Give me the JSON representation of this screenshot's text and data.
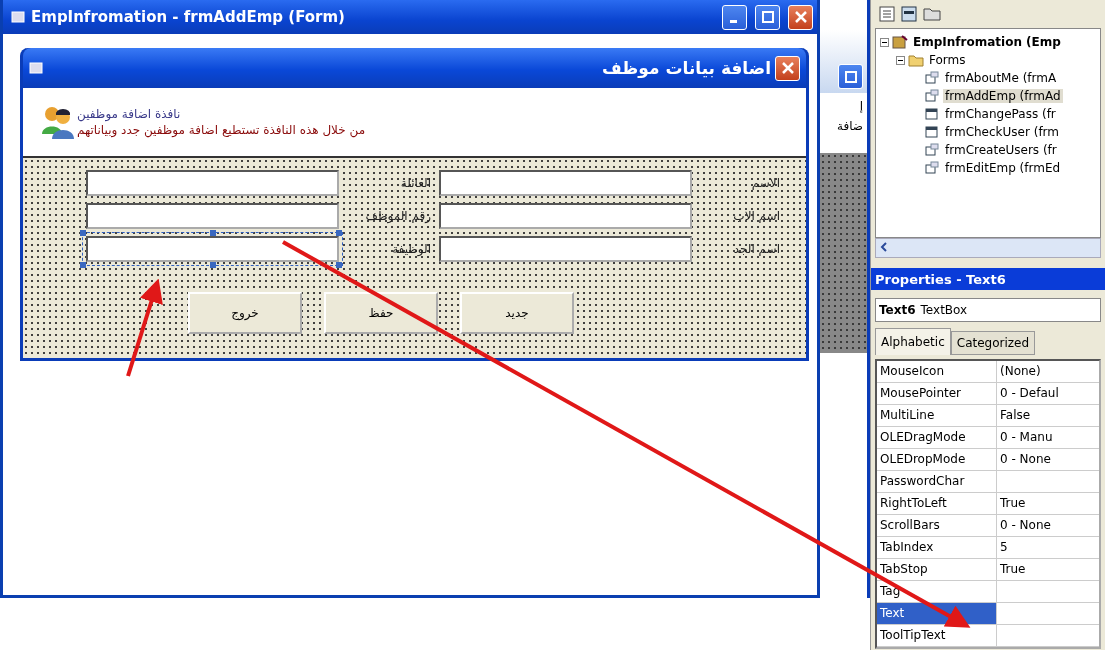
{
  "designer_window": {
    "title": "EmpInfromation - frmAddEmp (Form)"
  },
  "form": {
    "title": "اضافة بيانات موظف",
    "header_title": "نافذة اضافة موظفين",
    "header_text": "من خلال هذه النافذة تستطيع اضافة موظفين جدد وبياناتهم",
    "right_column": [
      {
        "label": "الاسم",
        "selected": false
      },
      {
        "label": "اسم الاب",
        "selected": false
      },
      {
        "label": "اسم الجد",
        "selected": false
      }
    ],
    "left_column": [
      {
        "label": "العائلة",
        "selected": false
      },
      {
        "label": "رقم الموظف",
        "selected": false
      },
      {
        "label": "الوظيفة",
        "selected": true
      }
    ],
    "buttons": [
      "جديد",
      "حفظ",
      "خروج"
    ]
  },
  "background_window": {
    "texts": [
      "إ",
      "ضافة"
    ]
  },
  "project": {
    "items": [
      {
        "label": "EmpInfromation (Emp",
        "kind": "project",
        "expanded": true,
        "selected": false,
        "children": [
          {
            "label": "Forms",
            "kind": "folder",
            "expanded": true,
            "selected": false,
            "children": [
              {
                "label": "frmAboutMe (frmA",
                "kind": "mdi-form",
                "selected": false
              },
              {
                "label": "frmAddEmp (frmAd",
                "kind": "mdi-form",
                "selected": true
              },
              {
                "label": "frmChangePass (fr",
                "kind": "form",
                "selected": false
              },
              {
                "label": "frmCheckUser (frm",
                "kind": "form",
                "selected": false
              },
              {
                "label": "frmCreateUsers (fr",
                "kind": "mdi-form",
                "selected": false
              },
              {
                "label": "frmEditEmp (frmEd",
                "kind": "mdi-form",
                "selected": false
              }
            ]
          }
        ]
      }
    ]
  },
  "properties": {
    "title": "Properties - Text6",
    "object_name": "Text6",
    "object_type": "TextBox",
    "tabs": [
      {
        "label": "Alphabetic",
        "selected": true
      },
      {
        "label": "Categorized",
        "selected": false
      }
    ],
    "rows": [
      {
        "name": "MouseIcon",
        "value": "(None)",
        "selected": false
      },
      {
        "name": "MousePointer",
        "value": "0 - Defaul",
        "selected": false
      },
      {
        "name": "MultiLine",
        "value": "False",
        "selected": false
      },
      {
        "name": "OLEDragMode",
        "value": "0 - Manu",
        "selected": false
      },
      {
        "name": "OLEDropMode",
        "value": "0 - None",
        "selected": false
      },
      {
        "name": "PasswordChar",
        "value": "",
        "selected": false
      },
      {
        "name": "RightToLeft",
        "value": "True",
        "selected": false
      },
      {
        "name": "ScrollBars",
        "value": "0 - None",
        "selected": false
      },
      {
        "name": "TabIndex",
        "value": "5",
        "selected": false
      },
      {
        "name": "TabStop",
        "value": "True",
        "selected": false
      },
      {
        "name": "Tag",
        "value": "",
        "selected": false
      },
      {
        "name": "Text",
        "value": "",
        "selected": true
      },
      {
        "name": "ToolTipText",
        "value": "",
        "selected": false
      }
    ]
  }
}
